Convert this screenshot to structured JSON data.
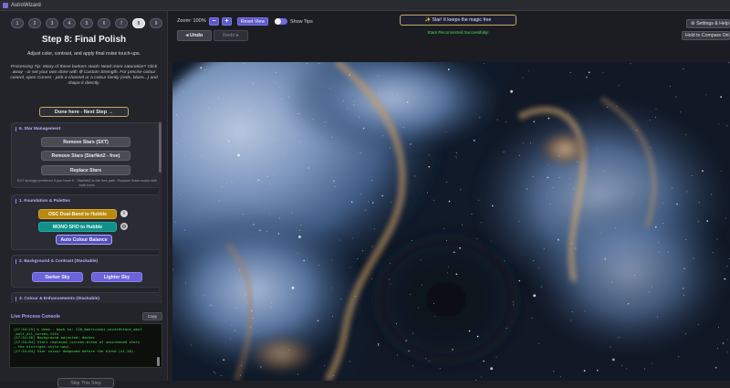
{
  "window": {
    "title": "AstroWizard"
  },
  "steps": {
    "labels": [
      "1",
      "2",
      "3",
      "4",
      "5",
      "6",
      "7",
      "8",
      "9"
    ],
    "active_index": 7
  },
  "step": {
    "title": "Step 8: Final Polish",
    "description": "Adjust color, contrast, and apply final noise touch-ups.",
    "tip": "Processing Tip: Many of these buttons stack! Need more saturation? Click away - or set your own dose with ⚙ Custom Strength. For precise colour control, open Curves - pick a channel or a colour family (reds, blues...) and shape it directly."
  },
  "panel": {
    "done_button": "Done here - Next Step →",
    "star_management": {
      "title": "5. Star Management",
      "remove_sxt": "Remove Stars (SXT)",
      "remove_starnet": "Remove Stars (StarNet2 - free)",
      "replace": "Replace Stars",
      "note": "SXT strongly preferred if you have it - StarNet2 is the free path. Replace Stars works with both tools."
    },
    "foundation": {
      "title": "1. Foundation & Palettes",
      "osc_hubble": "OSC Dual-Band to Hubble",
      "mono_sho": "MONO SHO to Hubble",
      "auto_balance": "Auto Colour Balance"
    },
    "background": {
      "title": "2. Background & Contrast (Stackable)",
      "darker": "Darker Sky",
      "lighter": "Lighter Sky"
    },
    "colour": {
      "title": "3. Colour & Enhancements (Stackable)"
    }
  },
  "console": {
    "label": "Live Process Console",
    "copy_label": "Copy",
    "lines": [
      "[17:54:25] ► Undo - back to: C20_Americanus_wizardstack_abuf",
      "_mult_all_curves.fits",
      "[17:54:26] Background adjusted: darker",
      "[17:54:04] Stars replaced (screen-blend of unscreened stars",
      "— the histright-style way).",
      "[17:54:04] Star colour deepened before the blend (x1.20)."
    ]
  },
  "skip_button": "Skip This Step",
  "toolbar": {
    "zoom_label": "Zoom: 100%",
    "zoom_out": "−",
    "zoom_in": "+",
    "reset_view": "Reset View",
    "show_tips": "Show Tips",
    "show_tips_on": true,
    "undo": "◂ Undo",
    "redo": "Redo ▸",
    "star_banner": "✨ Star! It keeps the magic free",
    "status": "Stars Reconnected Successfully!",
    "settings": "⚙ Settings & Help",
    "compare": "Hold to Compare Original"
  },
  "colors": {
    "accent": "#6a64d8",
    "gold": "#b8890f",
    "teal": "#138f8a",
    "console_text": "#44e44a",
    "status_green": "#48e056"
  }
}
